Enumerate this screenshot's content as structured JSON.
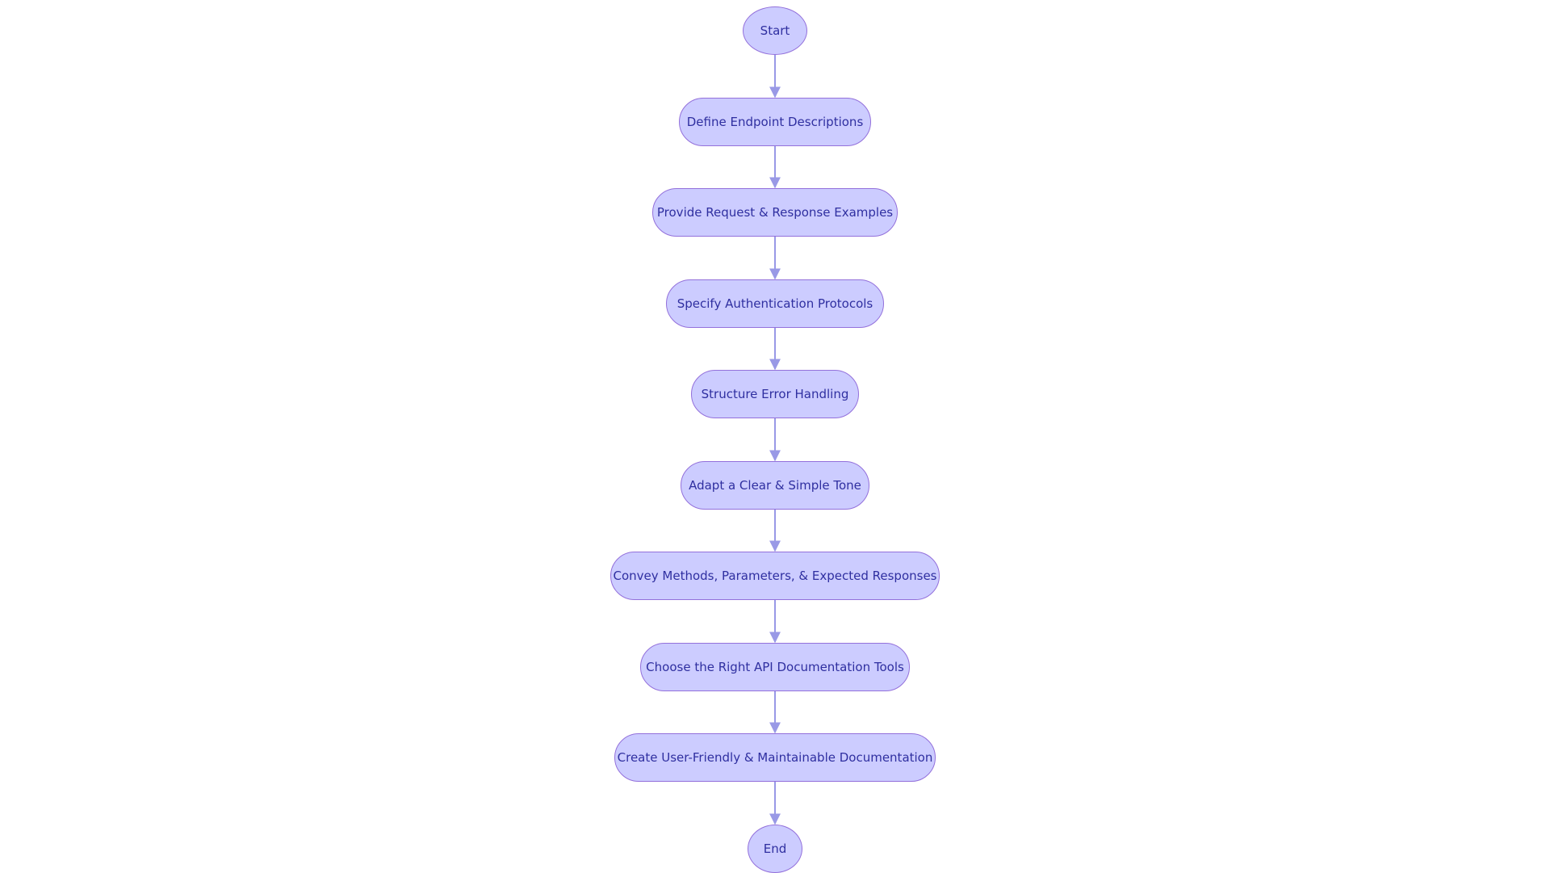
{
  "diagram": {
    "type": "flowchart",
    "direction": "top-to-bottom",
    "colors": {
      "node_fill": "#ccccff",
      "node_border": "#9370db",
      "text": "#2f2fa0",
      "edge": "#9999e6"
    },
    "nodes": [
      {
        "id": "start",
        "label": "Start",
        "shape": "circle"
      },
      {
        "id": "n1",
        "label": "Define Endpoint Descriptions",
        "shape": "stadium"
      },
      {
        "id": "n2",
        "label": "Provide Request & Response Examples",
        "shape": "stadium"
      },
      {
        "id": "n3",
        "label": "Specify Authentication Protocols",
        "shape": "stadium"
      },
      {
        "id": "n4",
        "label": "Structure Error Handling",
        "shape": "stadium"
      },
      {
        "id": "n5",
        "label": "Adapt a Clear & Simple Tone",
        "shape": "stadium"
      },
      {
        "id": "n6",
        "label": "Convey Methods, Parameters, & Expected Responses",
        "shape": "stadium"
      },
      {
        "id": "n7",
        "label": "Choose the Right API Documentation Tools",
        "shape": "stadium"
      },
      {
        "id": "n8",
        "label": "Create User-Friendly & Maintainable Documentation",
        "shape": "stadium"
      },
      {
        "id": "end",
        "label": "End",
        "shape": "circle"
      }
    ],
    "edges": [
      {
        "from": "start",
        "to": "n1"
      },
      {
        "from": "n1",
        "to": "n2"
      },
      {
        "from": "n2",
        "to": "n3"
      },
      {
        "from": "n3",
        "to": "n4"
      },
      {
        "from": "n4",
        "to": "n5"
      },
      {
        "from": "n5",
        "to": "n6"
      },
      {
        "from": "n6",
        "to": "n7"
      },
      {
        "from": "n7",
        "to": "n8"
      },
      {
        "from": "n8",
        "to": "end"
      }
    ]
  }
}
